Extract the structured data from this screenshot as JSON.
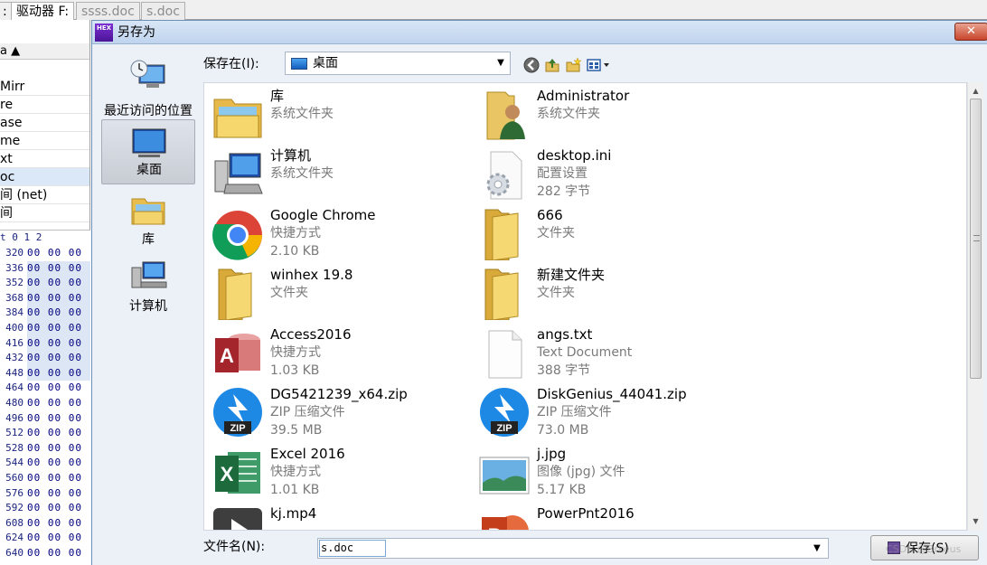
{
  "background_app": {
    "tabs": [
      ":",
      "驱动器 F:",
      "ssss.doc",
      "s.doc"
    ],
    "column_header": "a ▲",
    "files": [
      {
        "text": "Mirr",
        "selected": false
      },
      {
        "text": "re",
        "selected": false
      },
      {
        "text": "ase",
        "selected": false
      },
      {
        "text": "me",
        "selected": false
      },
      {
        "text": "xt",
        "selected": false
      },
      {
        "text": "oc",
        "selected": true
      },
      {
        "text": "间 (net)",
        "selected": false
      },
      {
        "text": "间",
        "selected": false
      }
    ],
    "hex_header": "t  0  1  2",
    "hex_rows": [
      {
        "offset": "320",
        "bytes": "00 00 00",
        "highlight": false
      },
      {
        "offset": "336",
        "bytes": "00 00 00",
        "highlight": true
      },
      {
        "offset": "352",
        "bytes": "00 00 00",
        "highlight": true
      },
      {
        "offset": "368",
        "bytes": "00 00 00",
        "highlight": true
      },
      {
        "offset": "384",
        "bytes": "00 00 00",
        "highlight": true
      },
      {
        "offset": "400",
        "bytes": "00 00 00",
        "highlight": true
      },
      {
        "offset": "416",
        "bytes": "00 00 00",
        "highlight": true
      },
      {
        "offset": "432",
        "bytes": "00 00 00",
        "highlight": true
      },
      {
        "offset": "448",
        "bytes": "00 00 00",
        "highlight": true
      },
      {
        "offset": "464",
        "bytes": "00 00 00",
        "highlight": false
      },
      {
        "offset": "480",
        "bytes": "00 00 00",
        "highlight": false
      },
      {
        "offset": "496",
        "bytes": "00 00 00",
        "highlight": false
      },
      {
        "offset": "512",
        "bytes": "00 00 00",
        "highlight": false
      },
      {
        "offset": "528",
        "bytes": "00 00 00",
        "highlight": false
      },
      {
        "offset": "544",
        "bytes": "00 00 00",
        "highlight": false
      },
      {
        "offset": "560",
        "bytes": "00 00 00",
        "highlight": false
      },
      {
        "offset": "576",
        "bytes": "00 00 00",
        "highlight": false
      },
      {
        "offset": "592",
        "bytes": "00 00 00",
        "highlight": false
      },
      {
        "offset": "608",
        "bytes": "00 00 00",
        "highlight": false
      },
      {
        "offset": "624",
        "bytes": "00 00 00",
        "highlight": false
      },
      {
        "offset": "640",
        "bytes": "00 00 00",
        "highlight": false
      }
    ]
  },
  "dialog": {
    "app_logo": "HEX",
    "title": "另存为",
    "close": "✕",
    "places": [
      {
        "label": "最近访问的位置",
        "icon": "recent-places-icon",
        "selected": false
      },
      {
        "label": "桌面",
        "icon": "desktop-icon",
        "selected": true
      },
      {
        "label": "库",
        "icon": "library-icon",
        "selected": false
      },
      {
        "label": "计算机",
        "icon": "computer-icon",
        "selected": false
      }
    ],
    "save_in_label": "保存在(I):",
    "location": "桌面",
    "toolbar_icons": [
      "back-icon",
      "up-folder-icon",
      "new-folder-icon",
      "view-menu-icon"
    ],
    "files": [
      {
        "name": "库",
        "type": "系统文件夹",
        "size": "",
        "icon": "library-folder-icon"
      },
      {
        "name": "Administrator",
        "type": "系统文件夹",
        "size": "",
        "icon": "user-folder-icon"
      },
      {
        "name": "计算机",
        "type": "系统文件夹",
        "size": "",
        "icon": "computer-icon"
      },
      {
        "name": "desktop.ini",
        "type": "配置设置",
        "size": "282 字节",
        "icon": "settings-file-icon"
      },
      {
        "name": "Google Chrome",
        "type": "快捷方式",
        "size": "2.10 KB",
        "icon": "chrome-icon"
      },
      {
        "name": "666",
        "type": "文件夹",
        "size": "",
        "icon": "folder-icon"
      },
      {
        "name": "winhex 19.8",
        "type": "文件夹",
        "size": "",
        "icon": "folder-icon"
      },
      {
        "name": "新建文件夹",
        "type": "文件夹",
        "size": "",
        "icon": "folder-icon"
      },
      {
        "name": "Access2016",
        "type": "快捷方式",
        "size": "1.03 KB",
        "icon": "access-icon"
      },
      {
        "name": "angs.txt",
        "type": "Text Document",
        "size": "388 字节",
        "icon": "text-file-icon"
      },
      {
        "name": "DG5421239_x64.zip",
        "type": "ZIP 压缩文件",
        "size": "39.5 MB",
        "icon": "zip-icon"
      },
      {
        "name": "DiskGenius_44041.zip",
        "type": "ZIP 压缩文件",
        "size": "73.0 MB",
        "icon": "zip-icon"
      },
      {
        "name": "Excel 2016",
        "type": "快捷方式",
        "size": "1.01 KB",
        "icon": "excel-icon"
      },
      {
        "name": "j.jpg",
        "type": "图像 (jpg) 文件",
        "size": "5.17 KB",
        "icon": "image-file-icon"
      },
      {
        "name": "kj.mp4",
        "type": "",
        "size": "",
        "icon": "video-file-icon"
      },
      {
        "name": "PowerPnt2016",
        "type": "",
        "size": "",
        "icon": "powerpoint-icon"
      }
    ],
    "filename_label": "文件名(N):",
    "filename_value": "s.doc",
    "save_button": "保存(S)",
    "watermark": "CSDN @Brkeus"
  }
}
